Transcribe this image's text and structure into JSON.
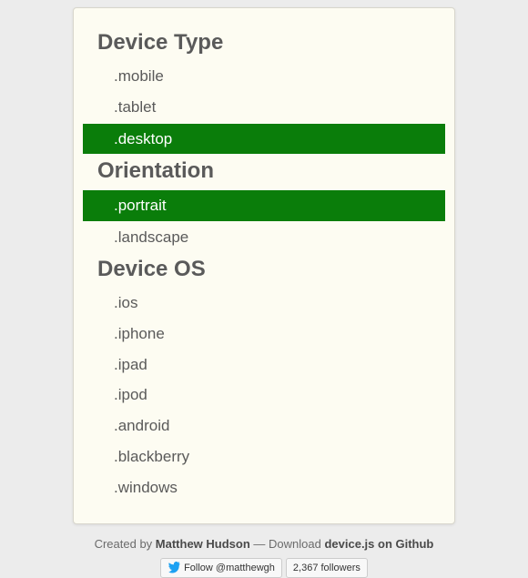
{
  "sections": {
    "deviceType": {
      "title": "Device Type",
      "items": [
        {
          "label": ".mobile",
          "active": false
        },
        {
          "label": ".tablet",
          "active": false
        },
        {
          "label": ".desktop",
          "active": true
        }
      ]
    },
    "orientation": {
      "title": "Orientation",
      "items": [
        {
          "label": ".portrait",
          "active": true
        },
        {
          "label": ".landscape",
          "active": false
        }
      ]
    },
    "deviceOS": {
      "title": "Device OS",
      "items": [
        {
          "label": ".ios",
          "active": false
        },
        {
          "label": ".iphone",
          "active": false
        },
        {
          "label": ".ipad",
          "active": false
        },
        {
          "label": ".ipod",
          "active": false
        },
        {
          "label": ".android",
          "active": false
        },
        {
          "label": ".blackberry",
          "active": false
        },
        {
          "label": ".windows",
          "active": false
        }
      ]
    }
  },
  "footer": {
    "createdBy": "Created by ",
    "authorName": "Matthew Hudson",
    "separator": " — ",
    "downloadPrefix": "Download ",
    "repoName": "device.js on Github",
    "twitterFollow": "Follow @matthewgh",
    "twitterFollowers": "2,367 followers"
  }
}
